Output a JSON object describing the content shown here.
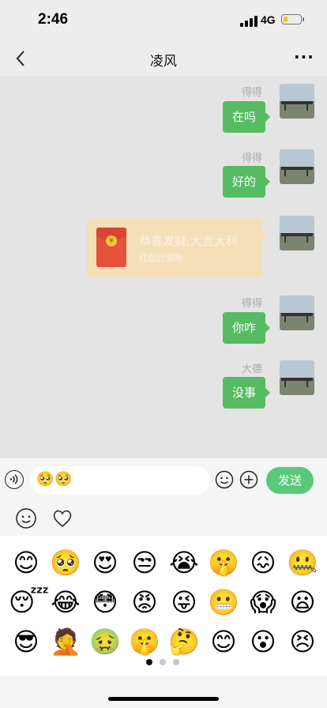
{
  "status_bar": {
    "time": "2:46",
    "network": "4G",
    "battery_level": 0.25
  },
  "nav": {
    "title": "凌风",
    "more_label": "···"
  },
  "messages": [
    {
      "sender": "得得",
      "text": "在吗"
    },
    {
      "sender": "得得",
      "text": "好的"
    },
    {
      "type": "red_packet",
      "title": "恭喜发财,大吉大利",
      "subtitle": "红包已领完"
    },
    {
      "sender": "得得",
      "text": "你咋"
    },
    {
      "sender": "大德",
      "text": "没事"
    }
  ],
  "input": {
    "value": "🥺🥺",
    "send_label": "发送"
  },
  "emoji_panel": {
    "tabs": [
      "smile-icon",
      "heart-icon"
    ],
    "rows": [
      [
        "😊",
        "🥺",
        "😍",
        "😒",
        "😭",
        "🤫",
        "😖",
        "🤐"
      ],
      [
        "😴",
        "😂",
        "😳",
        "😡",
        "😜",
        "😬",
        "😱",
        "😦"
      ],
      [
        "😎",
        "🤦",
        "🤢",
        "🤫",
        "🤔",
        "😊",
        "😮",
        "😣"
      ]
    ],
    "page_count": 3,
    "active_page": 1
  },
  "colors": {
    "accent": "#57bb62",
    "send": "#58c97b",
    "red_packet_bg": "#f4dfb9"
  }
}
